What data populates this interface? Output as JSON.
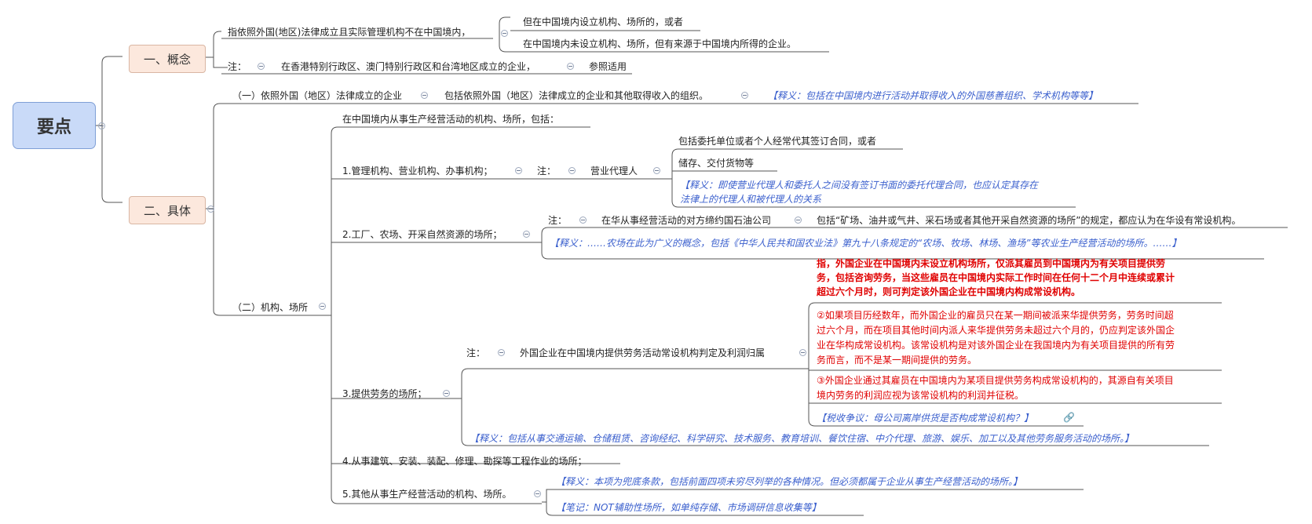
{
  "root": "要点",
  "concept": {
    "label": "一、概念",
    "definition": "指依照外国(地区)法律成立且实际管理机构不在中国境内，",
    "case1": "但在中国境内设立机构、场所的，或者",
    "case2": "在中国境内未设立机构、场所，但有来源于中国境内所得的企业。",
    "note_label": "注：",
    "note_text": "在香港特别行政区、澳门特别行政区和台湾地区成立的企业，",
    "note_ref": "参照适用"
  },
  "specific": {
    "label": "二、具体",
    "item1": {
      "label": "（一）依照外国（地区）法律成立的企业",
      "detail": "包括依照外国（地区）法律成立的企业和其他取得收入的组织。",
      "interpretation": "【释义：包括在中国境内进行活动并取得收入的外国慈善组织、学术机构等等】"
    },
    "item2": {
      "label": "（二）机构、场所",
      "intro": "在中国境内从事生产经营活动的机构、场所，包括：",
      "sub1": {
        "label": "1.管理机构、营业机构、办事机构；",
        "note": "注：",
        "agent": "营业代理人",
        "a1": "包括委托单位或者个人经常代其签订合同，或者",
        "a2": "储存、交付货物等",
        "interp_line1": "【释义：即使营业代理人和委托人之间没有签订书面的委托代理合同，也应认定其存在",
        "interp_line2": "法律上的代理人和被代理人的关系"
      },
      "sub2": {
        "label": "2.工厂、农场、开采自然资源的场所；",
        "note": "注：",
        "treaty": "在华从事经营活动的对方缔约国石油公司",
        "treaty_detail": "包括“矿场、油井或气井、采石场或者其他开采自然资源的场所”的规定，都应认为在华设有常设机构。",
        "interp": "【释义：……农场在此为广义的概念，包括《中华人民共和国农业法》第九十八条规定的“农场、牧场、林场、渔场”等农业生产经营活动的场所。……】"
      },
      "sub3": {
        "label": "3.提供劳务的场所；",
        "note": "注：",
        "topic": "外国企业在中国境内提供劳务活动常设机构判定及利润归属",
        "bold_lines": [
          "指，外国企业在中国境内未设立机构场所，仅派其雇员到中国境内为有关项目提供劳",
          "务，包括咨询劳务，当这些雇员在中国境内实际工作时间在任何十二个月中连续或累计",
          "超过六个月时，则可判定该外国企业在中国境内构成常设机构。"
        ],
        "p2_lines": [
          "②如果项目历经数年，而外国企业的雇员只在某一期间被派来华提供劳务，劳务时间超",
          "过六个月，而在项目其他时间内派人来华提供劳务未超过六个月的，仍应判定该外国企",
          "业在华构成常设机构。该常设机构是对该外国企业在我国境内为有关项目提供的所有劳",
          "务而言，而不是某一期间提供的劳务。"
        ],
        "p3_lines": [
          "③外国企业通过其雇员在中国境内为某项目提供劳务构成常设机构的，其源自有关项目",
          "境内劳务的利润应视为该常设机构的利润并征税。"
        ],
        "dispute": "【税收争议：母公司离岸供货是否构成常设机构？】",
        "interp": "【释义：包括从事交通运输、仓储租赁、咨询经纪、科学研究、技术服务、教育培训、餐饮住宿、中介代理、旅游、娱乐、加工以及其他劳务服务活动的场所。】"
      },
      "sub4": {
        "label": "4.从事建筑、安装、装配、修理、勘探等工程作业的场所；"
      },
      "sub5": {
        "label": "5.其他从事生产经营活动的机构、场所。",
        "interp": "【释义：本项为兜底条款，包括前面四项未穷尽列举的各种情况。但必须都属于企业从事生产经营活动的场所。】",
        "memo": "【笔记：NOT辅助性场所，如单纯存储、市场调研信息收集等】"
      }
    }
  },
  "colors": {
    "root_fill": "#c9daf8",
    "branch_fill": "#fce8dd",
    "interp_blue": "#3a5fcd",
    "highlight_red": "#e00000"
  }
}
